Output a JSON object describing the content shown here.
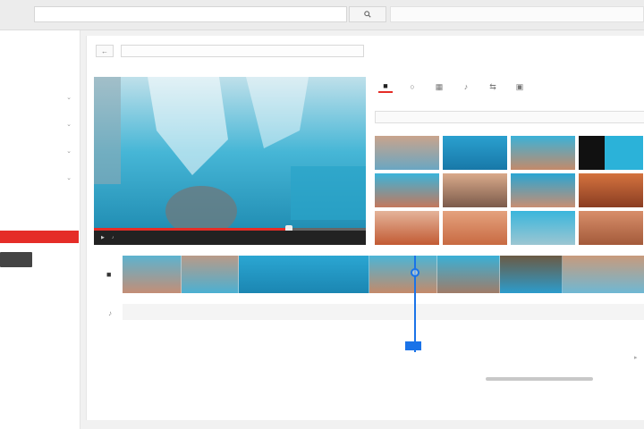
{
  "search": {
    "value": "",
    "placeholder": ""
  },
  "icons": {
    "search": "search-icon",
    "back": "arrow-left-icon",
    "video_track": "camera-icon",
    "music_track": "music-note-icon"
  },
  "sidebar": {
    "items": [
      {
        "label": "",
        "has_chevron": false,
        "state": "normal"
      },
      {
        "label": "",
        "has_chevron": false,
        "state": "normal"
      },
      {
        "label": "",
        "has_chevron": true,
        "state": "normal"
      },
      {
        "label": "",
        "has_chevron": true,
        "state": "normal"
      },
      {
        "label": "",
        "has_chevron": true,
        "state": "normal"
      },
      {
        "label": "",
        "has_chevron": true,
        "state": "normal"
      },
      {
        "label": "",
        "has_chevron": false,
        "state": "red"
      },
      {
        "label": "",
        "has_chevron": false,
        "state": "normal"
      },
      {
        "label": "",
        "has_chevron": false,
        "state": "active"
      }
    ],
    "button_label": ""
  },
  "editor": {
    "breadcrumb": [
      "",
      ""
    ],
    "header_right": "",
    "clip_search_placeholder": "",
    "music_track_label": "",
    "preview_time": "",
    "playhead_time": "",
    "footer_text": "",
    "tools": [
      {
        "icon": "camera-icon",
        "active": true
      },
      {
        "icon": "circle-icon",
        "active": false
      },
      {
        "icon": "grid-icon",
        "active": false
      },
      {
        "icon": "music-icon",
        "active": false
      },
      {
        "icon": "transition-icon",
        "active": false
      },
      {
        "icon": "text-icon",
        "active": false
      }
    ],
    "ruler_labels": [
      "",
      "",
      "",
      "",
      "",
      "",
      ""
    ]
  },
  "colors": {
    "accent": "#e52d27",
    "playhead": "#1a73e8",
    "water": "#1e8fb0"
  }
}
